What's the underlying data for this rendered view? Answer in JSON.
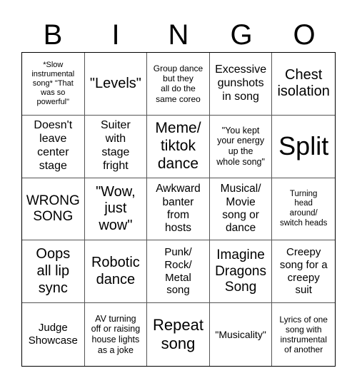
{
  "header": [
    "B",
    "I",
    "N",
    "G",
    "O"
  ],
  "cells": [
    "*Slow\ninstrumental\nsong* \"That\nwas so\npowerful\"",
    "\"Levels\"",
    "Group dance\nbut they\nall do the\nsame coreo",
    "Excessive\ngunshots\nin song",
    "Chest\nisolation",
    "Doesn't\nleave\ncenter\nstage",
    "Suiter\nwith\nstage\nfright",
    "Meme/\ntiktok\ndance",
    "\"You kept\nyour energy\nup the\nwhole song\"",
    "Split",
    "WRONG\nSONG",
    "\"Wow,\njust\nwow\"",
    "Awkward\nbanter\nfrom\nhosts",
    "Musical/\nMovie\nsong or\ndance",
    "Turning\nhead\naround/\nswitch heads",
    "Oops\nall lip\nsync",
    "Robotic\ndance",
    "Punk/\nRock/\nMetal\nsong",
    "Imagine\nDragons\nSong",
    "Creepy\nsong for a\ncreepy\nsuit",
    "Judge\nShowcase",
    "AV turning\noff or raising\nhouse lights\nas a joke",
    "Repeat\nsong",
    "\"Musicality\"",
    "Lyrics of one\nsong with\ninstrumental\nof another"
  ]
}
